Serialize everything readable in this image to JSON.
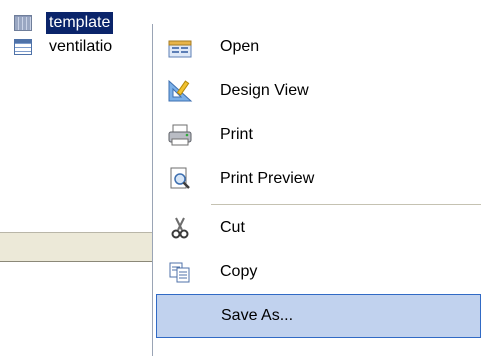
{
  "object_list": {
    "items": [
      {
        "name": "template",
        "selected": true,
        "icon": "form-icon"
      },
      {
        "name": "ventilatio",
        "selected": false,
        "icon": "table-icon"
      }
    ]
  },
  "context_menu": {
    "items": [
      {
        "label": "Open",
        "icon": "open-form-icon"
      },
      {
        "label": "Design View",
        "icon": "design-view-icon"
      },
      {
        "label": "Print",
        "icon": "printer-icon"
      },
      {
        "label": "Print Preview",
        "icon": "print-preview-icon"
      },
      {
        "label": "Cut",
        "icon": "scissors-icon"
      },
      {
        "label": "Copy",
        "icon": "copy-icon"
      },
      {
        "label": "Save As...",
        "icon": null,
        "highlighted": true
      }
    ]
  }
}
